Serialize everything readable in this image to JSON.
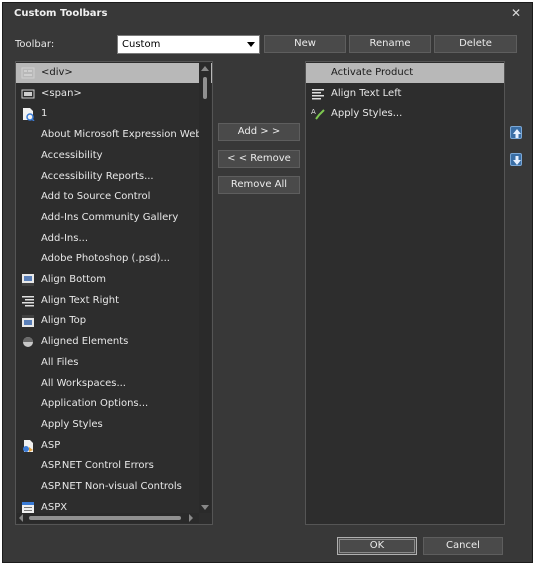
{
  "dialog": {
    "title": "Custom Toolbars",
    "close_glyph": "✕"
  },
  "toolbar_row": {
    "label": "Toolbar:",
    "selected": "Custom",
    "buttons": {
      "new": "New",
      "rename": "Rename",
      "delete": "Delete"
    }
  },
  "available": {
    "items": [
      {
        "label": "<div>",
        "icon": "div-icon",
        "selected": true
      },
      {
        "label": "<span>",
        "icon": "span-icon"
      },
      {
        "label": "1",
        "icon": "page-magnifier-icon"
      },
      {
        "label": "About Microsoft Expression Web"
      },
      {
        "label": "Accessibility"
      },
      {
        "label": "Accessibility Reports..."
      },
      {
        "label": "Add to Source Control"
      },
      {
        "label": "Add-Ins Community Gallery"
      },
      {
        "label": "Add-Ins..."
      },
      {
        "label": "Adobe Photoshop (.psd)..."
      },
      {
        "label": "Align Bottom",
        "icon": "align-bottom-icon"
      },
      {
        "label": "Align Text Right",
        "icon": "align-text-right-icon"
      },
      {
        "label": "Align Top",
        "icon": "align-top-icon"
      },
      {
        "label": "Aligned Elements",
        "icon": "aligned-elements-icon"
      },
      {
        "label": "All Files"
      },
      {
        "label": "All Workspaces..."
      },
      {
        "label": "Application Options..."
      },
      {
        "label": "Apply Styles"
      },
      {
        "label": "ASP",
        "icon": "asp-icon"
      },
      {
        "label": "ASP.NET Control Errors"
      },
      {
        "label": "ASP.NET Non-visual Controls"
      },
      {
        "label": "ASPX",
        "icon": "aspx-icon"
      }
    ]
  },
  "middle_buttons": {
    "add": "Add > >",
    "remove": "< < Remove",
    "remove_all": "Remove All"
  },
  "current": {
    "items": [
      {
        "label": "Activate Product",
        "selected": true
      },
      {
        "label": "Align Text Left",
        "icon": "align-text-left-icon"
      },
      {
        "label": "Apply Styles...",
        "icon": "apply-styles-icon"
      }
    ]
  },
  "footer": {
    "ok": "OK",
    "cancel": "Cancel"
  }
}
